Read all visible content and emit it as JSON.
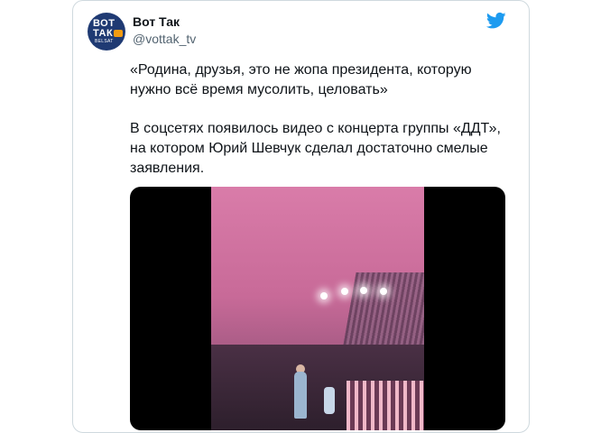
{
  "tweet": {
    "author": {
      "name": "Вот Так",
      "handle": "@vottak_tv",
      "avatar_text": {
        "line1": "ВОТ",
        "line2": "ТАК",
        "line3": "BELSAT"
      }
    },
    "quote": "«Родина, друзья, это не жопа президента, которую нужно всё время мусолить, целовать»",
    "body": "В соцсетях появилось видео с концерта группы «ДДТ», на котором Юрий Шевчук сделал достаточно смелые заявления.",
    "media": {
      "type": "video"
    }
  },
  "colors": {
    "twitter_blue": "#1d9bf0",
    "avatar_bg": "#1f3a73",
    "text": "#0f1419",
    "secondary_text": "#536471",
    "border": "#cfd9de"
  }
}
